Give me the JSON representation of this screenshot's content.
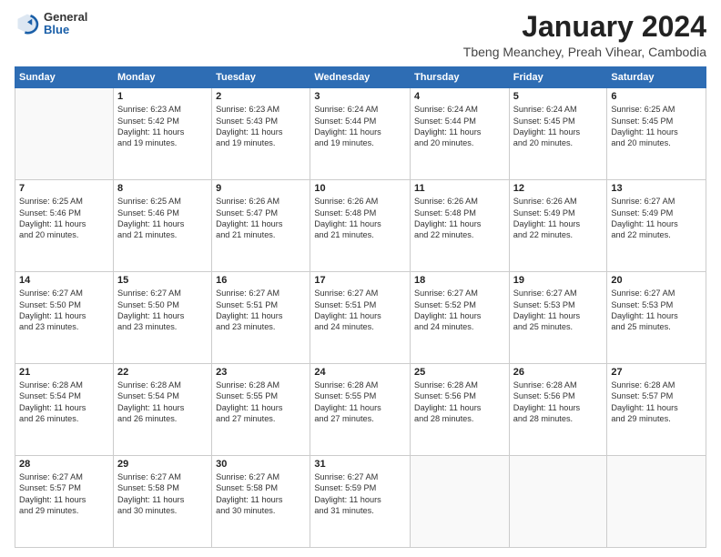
{
  "logo": {
    "general": "General",
    "blue": "Blue"
  },
  "title": "January 2024",
  "subtitle": "Tbeng Meanchey, Preah Vihear, Cambodia",
  "days_header": [
    "Sunday",
    "Monday",
    "Tuesday",
    "Wednesday",
    "Thursday",
    "Friday",
    "Saturday"
  ],
  "weeks": [
    [
      {
        "day": "",
        "content": ""
      },
      {
        "day": "1",
        "content": "Sunrise: 6:23 AM\nSunset: 5:42 PM\nDaylight: 11 hours\nand 19 minutes."
      },
      {
        "day": "2",
        "content": "Sunrise: 6:23 AM\nSunset: 5:43 PM\nDaylight: 11 hours\nand 19 minutes."
      },
      {
        "day": "3",
        "content": "Sunrise: 6:24 AM\nSunset: 5:44 PM\nDaylight: 11 hours\nand 19 minutes."
      },
      {
        "day": "4",
        "content": "Sunrise: 6:24 AM\nSunset: 5:44 PM\nDaylight: 11 hours\nand 20 minutes."
      },
      {
        "day": "5",
        "content": "Sunrise: 6:24 AM\nSunset: 5:45 PM\nDaylight: 11 hours\nand 20 minutes."
      },
      {
        "day": "6",
        "content": "Sunrise: 6:25 AM\nSunset: 5:45 PM\nDaylight: 11 hours\nand 20 minutes."
      }
    ],
    [
      {
        "day": "7",
        "content": "Sunrise: 6:25 AM\nSunset: 5:46 PM\nDaylight: 11 hours\nand 20 minutes."
      },
      {
        "day": "8",
        "content": "Sunrise: 6:25 AM\nSunset: 5:46 PM\nDaylight: 11 hours\nand 21 minutes."
      },
      {
        "day": "9",
        "content": "Sunrise: 6:26 AM\nSunset: 5:47 PM\nDaylight: 11 hours\nand 21 minutes."
      },
      {
        "day": "10",
        "content": "Sunrise: 6:26 AM\nSunset: 5:48 PM\nDaylight: 11 hours\nand 21 minutes."
      },
      {
        "day": "11",
        "content": "Sunrise: 6:26 AM\nSunset: 5:48 PM\nDaylight: 11 hours\nand 22 minutes."
      },
      {
        "day": "12",
        "content": "Sunrise: 6:26 AM\nSunset: 5:49 PM\nDaylight: 11 hours\nand 22 minutes."
      },
      {
        "day": "13",
        "content": "Sunrise: 6:27 AM\nSunset: 5:49 PM\nDaylight: 11 hours\nand 22 minutes."
      }
    ],
    [
      {
        "day": "14",
        "content": "Sunrise: 6:27 AM\nSunset: 5:50 PM\nDaylight: 11 hours\nand 23 minutes."
      },
      {
        "day": "15",
        "content": "Sunrise: 6:27 AM\nSunset: 5:50 PM\nDaylight: 11 hours\nand 23 minutes."
      },
      {
        "day": "16",
        "content": "Sunrise: 6:27 AM\nSunset: 5:51 PM\nDaylight: 11 hours\nand 23 minutes."
      },
      {
        "day": "17",
        "content": "Sunrise: 6:27 AM\nSunset: 5:51 PM\nDaylight: 11 hours\nand 24 minutes."
      },
      {
        "day": "18",
        "content": "Sunrise: 6:27 AM\nSunset: 5:52 PM\nDaylight: 11 hours\nand 24 minutes."
      },
      {
        "day": "19",
        "content": "Sunrise: 6:27 AM\nSunset: 5:53 PM\nDaylight: 11 hours\nand 25 minutes."
      },
      {
        "day": "20",
        "content": "Sunrise: 6:27 AM\nSunset: 5:53 PM\nDaylight: 11 hours\nand 25 minutes."
      }
    ],
    [
      {
        "day": "21",
        "content": "Sunrise: 6:28 AM\nSunset: 5:54 PM\nDaylight: 11 hours\nand 26 minutes."
      },
      {
        "day": "22",
        "content": "Sunrise: 6:28 AM\nSunset: 5:54 PM\nDaylight: 11 hours\nand 26 minutes."
      },
      {
        "day": "23",
        "content": "Sunrise: 6:28 AM\nSunset: 5:55 PM\nDaylight: 11 hours\nand 27 minutes."
      },
      {
        "day": "24",
        "content": "Sunrise: 6:28 AM\nSunset: 5:55 PM\nDaylight: 11 hours\nand 27 minutes."
      },
      {
        "day": "25",
        "content": "Sunrise: 6:28 AM\nSunset: 5:56 PM\nDaylight: 11 hours\nand 28 minutes."
      },
      {
        "day": "26",
        "content": "Sunrise: 6:28 AM\nSunset: 5:56 PM\nDaylight: 11 hours\nand 28 minutes."
      },
      {
        "day": "27",
        "content": "Sunrise: 6:28 AM\nSunset: 5:57 PM\nDaylight: 11 hours\nand 29 minutes."
      }
    ],
    [
      {
        "day": "28",
        "content": "Sunrise: 6:27 AM\nSunset: 5:57 PM\nDaylight: 11 hours\nand 29 minutes."
      },
      {
        "day": "29",
        "content": "Sunrise: 6:27 AM\nSunset: 5:58 PM\nDaylight: 11 hours\nand 30 minutes."
      },
      {
        "day": "30",
        "content": "Sunrise: 6:27 AM\nSunset: 5:58 PM\nDaylight: 11 hours\nand 30 minutes."
      },
      {
        "day": "31",
        "content": "Sunrise: 6:27 AM\nSunset: 5:59 PM\nDaylight: 11 hours\nand 31 minutes."
      },
      {
        "day": "",
        "content": ""
      },
      {
        "day": "",
        "content": ""
      },
      {
        "day": "",
        "content": ""
      }
    ]
  ]
}
